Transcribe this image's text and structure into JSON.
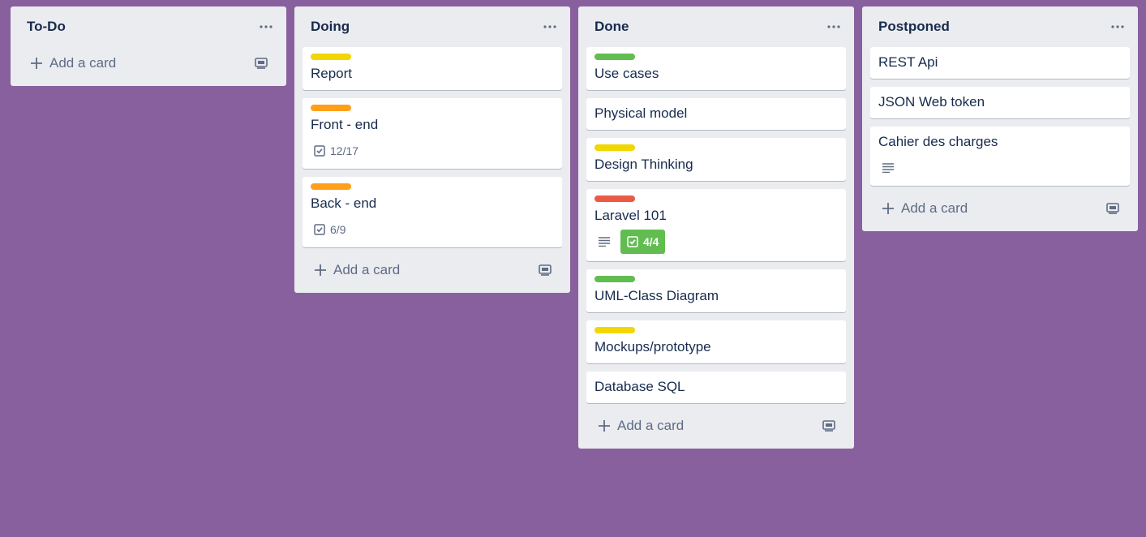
{
  "colors": {
    "background": "#89609e",
    "list_bg": "#ebecf0",
    "label_yellow": "#f2d600",
    "label_orange": "#ff9f1a",
    "label_green": "#61bd4f",
    "label_red": "#eb5a46"
  },
  "add_card_label": "Add a card",
  "lists": [
    {
      "title": "To-Do",
      "cards": []
    },
    {
      "title": "Doing",
      "cards": [
        {
          "title": "Report",
          "label": "yellow"
        },
        {
          "title": "Front - end",
          "label": "orange",
          "checklist": "12/17"
        },
        {
          "title": "Back - end",
          "label": "orange",
          "checklist": "6/9"
        }
      ]
    },
    {
      "title": "Done",
      "cards": [
        {
          "title": "Use cases",
          "label": "green"
        },
        {
          "title": "Physical model"
        },
        {
          "title": "Design Thinking",
          "label": "yellow"
        },
        {
          "title": "Laravel 101",
          "label": "red",
          "description": true,
          "checklist": "4/4",
          "checklist_complete": true
        },
        {
          "title": "UML-Class Diagram",
          "label": "green"
        },
        {
          "title": "Mockups/prototype",
          "label": "yellow"
        },
        {
          "title": "Database SQL"
        }
      ]
    },
    {
      "title": "Postponed",
      "cards": [
        {
          "title": "REST Api"
        },
        {
          "title": "JSON Web token"
        },
        {
          "title": "Cahier des charges",
          "description": true
        }
      ]
    }
  ]
}
